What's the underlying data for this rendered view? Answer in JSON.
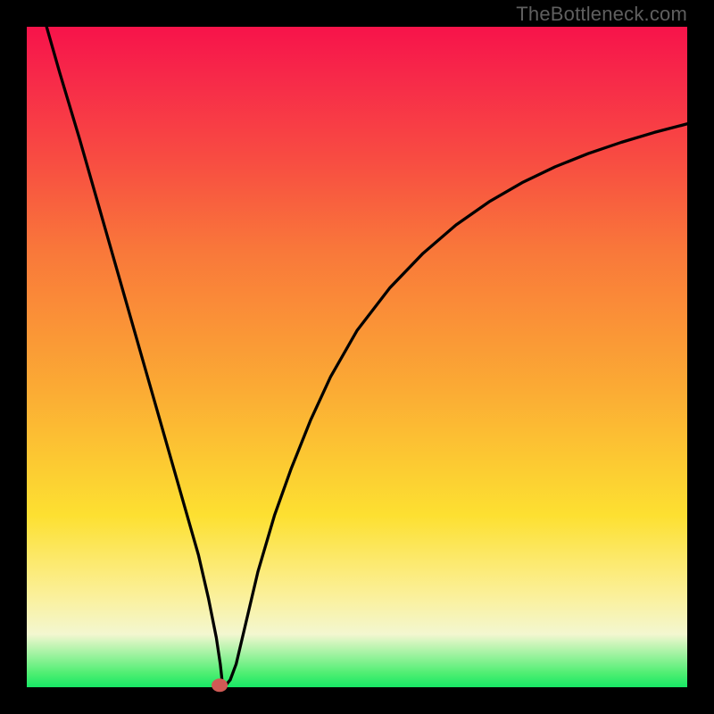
{
  "watermark": "TheBottleneck.com",
  "gradient_colors": {
    "top": "#f7134a",
    "upper_mid": "#f9783a",
    "mid": "#fbab34",
    "lower_mid": "#fde031",
    "pale": "#f3f7d0",
    "bottom": "#17e765"
  },
  "chart_data": {
    "type": "line",
    "title": "",
    "subtitle": "",
    "xlabel": "",
    "ylabel": "",
    "xlim": [
      0,
      100
    ],
    "ylim": [
      0,
      100
    ],
    "grid": false,
    "legend": false,
    "series": [
      {
        "name": "curve",
        "color": "#000000",
        "x": [
          3,
          5,
          8,
          11,
          14,
          17,
          20,
          23,
          26,
          27.5,
          28.7,
          29.3,
          29.5,
          29.6,
          30.2,
          30.8,
          31.7,
          33,
          35,
          37.5,
          40,
          43,
          46,
          50,
          55,
          60,
          65,
          70,
          75,
          80,
          85,
          90,
          95,
          100
        ],
        "y": [
          100,
          93,
          83,
          72.5,
          62,
          51.5,
          41,
          30.5,
          20,
          13.5,
          7.5,
          3.5,
          1.7,
          0.5,
          0.4,
          1.1,
          3.5,
          9,
          17.5,
          26,
          33,
          40.5,
          47,
          54,
          60.5,
          65.7,
          70,
          73.5,
          76.4,
          78.8,
          80.8,
          82.5,
          84,
          85.3
        ]
      }
    ],
    "marker": {
      "name": "minimum-point",
      "x": 29.2,
      "y": 0.3,
      "color": "#cf5a55",
      "radius_px": 9
    }
  }
}
